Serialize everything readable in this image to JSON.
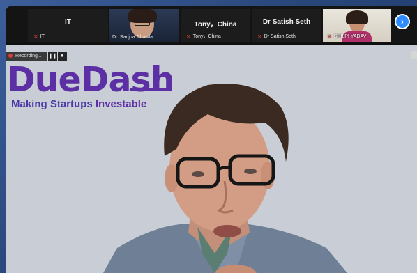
{
  "participants": [
    {
      "display_name": "IT",
      "label": "IT",
      "has_video": false
    },
    {
      "display_name": "",
      "label": "Dr. Sanjna Chawla",
      "has_video": true
    },
    {
      "display_name": "Tony，China",
      "label": "Tony，China",
      "has_video": false
    },
    {
      "display_name": "Dr Satish Seth",
      "label": "Dr Satish Seth",
      "has_video": false
    },
    {
      "display_name": "",
      "label": "SHILPI YADAV",
      "has_video": true
    }
  ],
  "recording": {
    "label": "Recording...",
    "pause_icon": "❚❚",
    "stop_icon": "■"
  },
  "next_icon": "›",
  "shared_screen": {
    "logo_text": "DueDash",
    "tagline_part1": "Making Startups ",
    "tagline_part2": "Investable"
  },
  "colors": {
    "brand": "#5c2fa4",
    "accent": "#2d8cff",
    "mic_muted": "#e03b3b"
  }
}
